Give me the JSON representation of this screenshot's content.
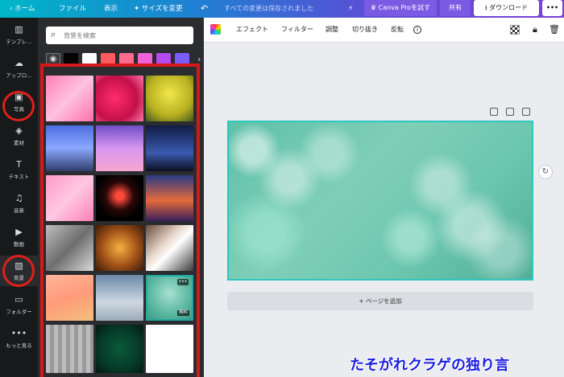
{
  "topbar": {
    "home": "‹ ホーム",
    "file": "ファイル",
    "view": "表示",
    "resize": "サイズを変更",
    "undo_icon": "undo-icon",
    "saved_status": "すべての変更は保存されました",
    "canva_pro": "Canva Proを試す",
    "share": "共有",
    "download": "ダウンロード",
    "more": "•••"
  },
  "rail": {
    "items": [
      {
        "label": "テンプレ…",
        "icon": "template-icon"
      },
      {
        "label": "アップロ…",
        "icon": "upload-icon"
      },
      {
        "label": "写真",
        "icon": "photo-icon"
      },
      {
        "label": "素材",
        "icon": "elements-icon"
      },
      {
        "label": "テキスト",
        "icon": "text-icon"
      },
      {
        "label": "音楽",
        "icon": "music-icon"
      },
      {
        "label": "動画",
        "icon": "video-icon"
      },
      {
        "label": "背景",
        "icon": "background-icon"
      },
      {
        "label": "フォルダー",
        "icon": "folder-icon"
      },
      {
        "label": "もっと見る",
        "icon": "more-icon"
      }
    ]
  },
  "panel": {
    "search_placeholder": "背景を検索",
    "swatches": [
      "#000000",
      "#ffffff",
      "#ff5a5f",
      "#ff6b8e",
      "#f063d8",
      "#b34bf0",
      "#7b5cff"
    ],
    "tiles": [
      {
        "style": "linear-gradient(135deg,#ff7fb4,#ffc2e0,#ff6fae)"
      },
      {
        "style": "radial-gradient(circle at 40% 50%,#ff2d6b,#c4104a 60%,#ff77a8)"
      },
      {
        "style": "radial-gradient(circle at 50% 40%,#f0e84a,#b8b020 60%,#3f5a1a)"
      },
      {
        "style": "linear-gradient(180deg,#4b6ee0,#8ca8ff 50%,#2f3d6a)"
      },
      {
        "style": "linear-gradient(180deg,#6f4ec6,#d896f0 50%,#f7a6d0)"
      },
      {
        "style": "linear-gradient(180deg,#101a44,#3a5ab0 60%,#0c0f1e)"
      },
      {
        "style": "linear-gradient(135deg,#ff9ac8,#ffc8e2,#ff7fb8)"
      },
      {
        "style": "radial-gradient(circle at 50% 45%,#ff4a3a 0 10%,#2a0808 40%,#000 70%)"
      },
      {
        "style": "linear-gradient(180deg,#2a3a86,#e46a3a 55%,#3a1f5c)"
      },
      {
        "style": "linear-gradient(135deg,#bdbdbd,#6e6e6e,#d8d8d8)"
      },
      {
        "style": "radial-gradient(circle at 50% 50%,#f5b040,#a05018 55%,#3a1a08)"
      },
      {
        "style": "linear-gradient(135deg,#6a4a3a,#e8d8cc 40%,#fff 55%,#3a3a3a)"
      },
      {
        "style": "linear-gradient(160deg,#ffb59a,#ff9a7a 50%,#f4c07a)"
      },
      {
        "style": "linear-gradient(180deg,#6a8aa8,#cfd8e2 60%,#9aaab8)"
      },
      {
        "style": "radial-gradient(circle at 50% 40%,#a8e0d0,#5ab8a0 60%,#3f9a84)",
        "selected": true,
        "dots": "•••",
        "badge": "無料"
      },
      {
        "style": "repeating-linear-gradient(90deg,#bdbdbd 0 5px,#9a9a9a 5px 10px)"
      },
      {
        "style": "radial-gradient(circle at 50% 50%,#0a5a3a,#063a28 60%,#021a12)"
      },
      {
        "style": "#ffffff"
      }
    ]
  },
  "toolbar": {
    "color_picker_icon": "color-picker-icon",
    "effects": "エフェクト",
    "filter": "フィルター",
    "adjust": "調整",
    "crop": "切り抜き",
    "flip": "反転",
    "info": "i",
    "transparency_icon": "transparency-icon",
    "lock_icon": "lock-icon",
    "trash_icon": "trash-icon"
  },
  "canvas": {
    "add_page": "+ ページを追加",
    "rotate_icon": "refresh-icon"
  },
  "watermark": "たそがれクラゲの独り言",
  "page_control": "⌄"
}
